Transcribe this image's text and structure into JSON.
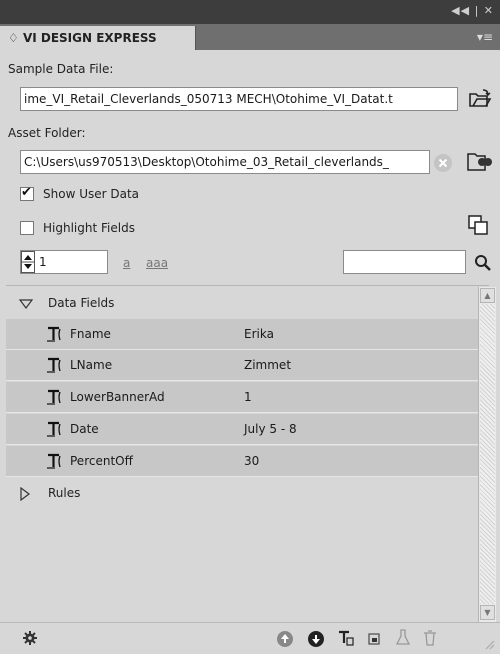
{
  "panel": {
    "title": "VI DESIGN EXPRESS",
    "title_prefix": "♢"
  },
  "sample": {
    "label": "Sample Data File:",
    "value": "ime_VI_Retail_Cleverlands_050713 MECH\\Otohime_VI_Datat.t"
  },
  "asset": {
    "label": "Asset Folder:",
    "value": "C:\\Users\\us970513\\Desktop\\Otohime_03_Retail_cleverlands_"
  },
  "options": {
    "show_user_data": "Show User Data",
    "highlight_fields": "Highlight Fields"
  },
  "record": {
    "value": "1",
    "case_lower": "a",
    "case_aaa": "aaa",
    "search_value": ""
  },
  "tree": {
    "data_fields_label": "Data Fields",
    "rules_label": "Rules",
    "fields": [
      {
        "name": "Fname",
        "value": "Erika"
      },
      {
        "name": "LName",
        "value": "Zimmet"
      },
      {
        "name": "LowerBannerAd",
        "value": "1"
      },
      {
        "name": "Date",
        "value": "July 5 - 8"
      },
      {
        "name": "PercentOff",
        "value": "30"
      }
    ]
  },
  "colors": {
    "panel_bg": "#d7d7d7",
    "titlebar": "#3d3d3d",
    "tabbar": "#6f6f6f",
    "accent_blue": "#2f5fa5"
  },
  "icons": {
    "titlebar": "collapse-close-icons",
    "menu": "panel-menu-icon",
    "browse_file": "open-folder-icon",
    "clear": "clear-x-icon",
    "browse_folder": "folder-binoculars-icon",
    "duplicate": "duplicate-icon",
    "search": "magnifier-icon",
    "settings": "gear-icon",
    "up": "arrow-up-circle-icon",
    "down": "arrow-down-circle-icon",
    "text_field": "text-insert-icon",
    "image": "image-frame-icon",
    "bottle": "flask-icon",
    "trash": "trash-icon"
  }
}
